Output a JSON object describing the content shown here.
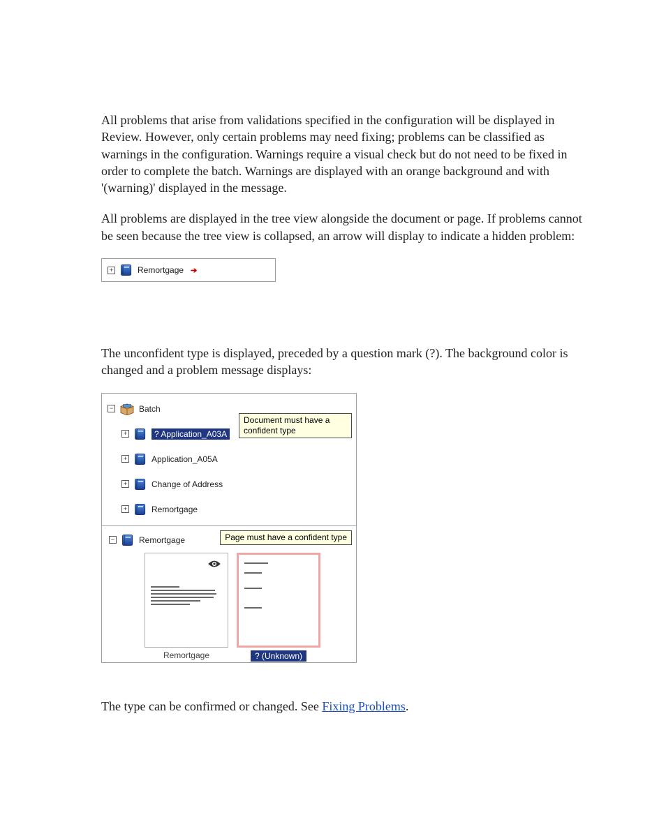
{
  "para1": "All problems that arise from validations specified in the configuration will be displayed in Review. However, only certain problems may need fixing; problems can be classified as warnings in the configuration. Warnings require a visual check but do not need to be fixed in order to complete the batch. Warnings are displayed with an orange background and with '(warning)' displayed in the message.",
  "para2": "All problems are displayed in the tree view alongside the document or page. If problems cannot be seen because the tree view is collapsed, an arrow will display to indicate a hidden problem:",
  "shot1": {
    "expand_glyph": "+",
    "label": "Remortgage"
  },
  "para3": "The unconfident type is displayed, preceded by a question mark (?). The background color is changed and a problem message displays:",
  "shot2": {
    "root_label": "Batch",
    "tooltip": "Document must have a confident type",
    "items": [
      {
        "expand": "+",
        "label": "? Application_A03A",
        "selected": true
      },
      {
        "expand": "+",
        "label": "Application_A05A",
        "selected": false
      },
      {
        "expand": "+",
        "label": "Change of Address",
        "selected": false
      },
      {
        "expand": "+",
        "label": "Remortgage",
        "selected": false
      }
    ]
  },
  "shot3": {
    "root_expand": "−",
    "root_label": "Remortgage",
    "tooltip": "Page must have a confident type",
    "thumb1_caption": "Remortgage",
    "thumb2_caption": "? (Unknown)"
  },
  "para4_prefix": "The type can be confirmed or changed. See ",
  "para4_link": "Fixing Problems",
  "para4_suffix": "."
}
